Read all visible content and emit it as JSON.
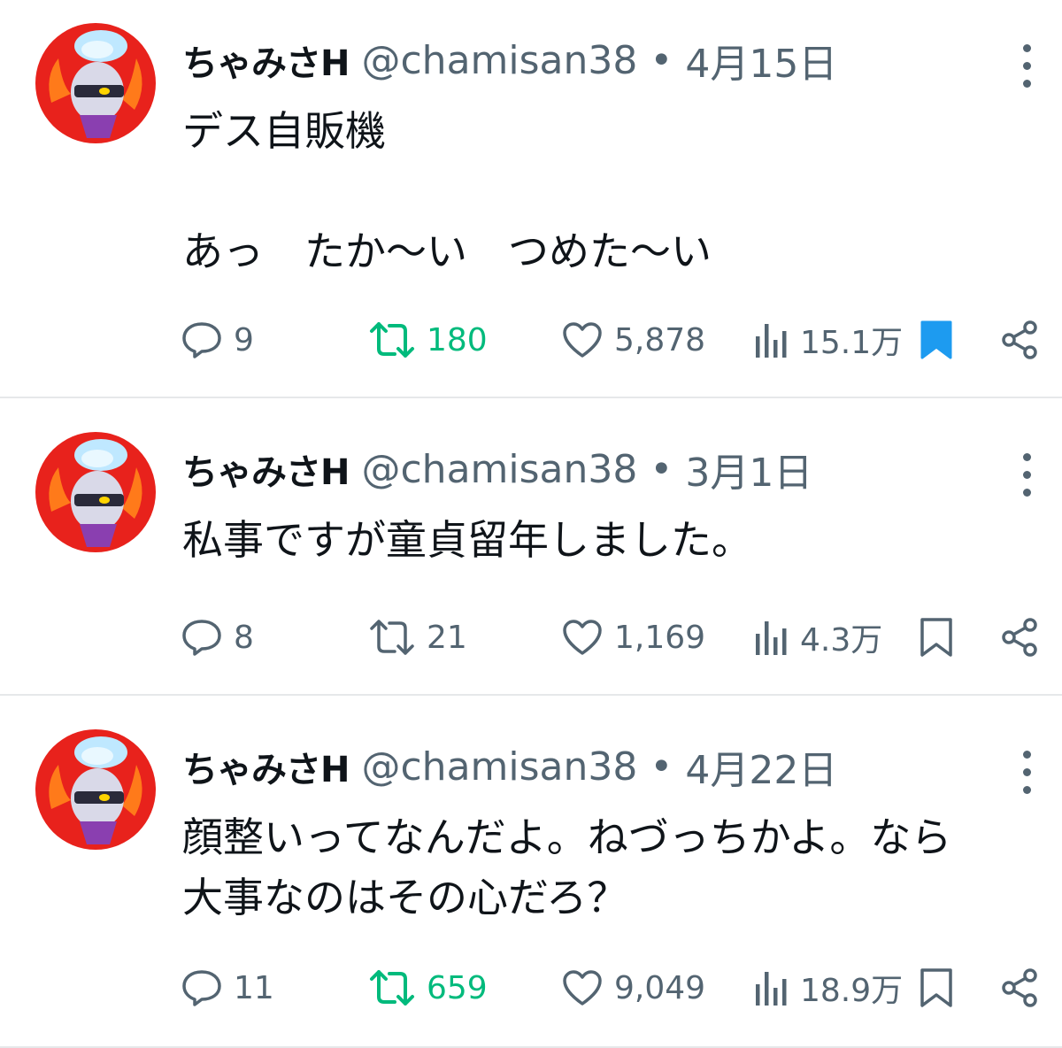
{
  "tweets": [
    {
      "name": "ちゃみさH",
      "handle": "@chamisan38",
      "dot": "•",
      "date": "4月15日",
      "text": "デス自販機\n\nあっ　たか〜い　つめた〜い",
      "replies": "9",
      "retweets": "180",
      "likes": "5,878",
      "views": "15.1万",
      "retweeted": true,
      "bookmarked": true
    },
    {
      "name": "ちゃみさH",
      "handle": "@chamisan38",
      "dot": "•",
      "date": "3月1日",
      "text": "私事ですが童貞留年しました。",
      "replies": "8",
      "retweets": "21",
      "likes": "1,169",
      "views": "4.3万",
      "retweeted": false,
      "bookmarked": false
    },
    {
      "name": "ちゃみさH",
      "handle": "@chamisan38",
      "dot": "•",
      "date": "4月22日",
      "text": "顔整いってなんだよ。ねづっちかよ。なら\n大事なのはその心だろ？",
      "replies": "11",
      "retweets": "659",
      "likes": "9,049",
      "views": "18.9万",
      "retweeted": true,
      "bookmarked": false
    }
  ],
  "colors": {
    "text": "#0f1419",
    "secondary": "#536471",
    "retweet_active": "#00ba7c",
    "bookmark_active": "#1d9bf0",
    "divider": "#e6e8ea"
  },
  "icons": [
    "reply-icon",
    "retweet-icon",
    "like-icon",
    "views-icon",
    "bookmark-icon",
    "share-icon",
    "more-icon"
  ]
}
